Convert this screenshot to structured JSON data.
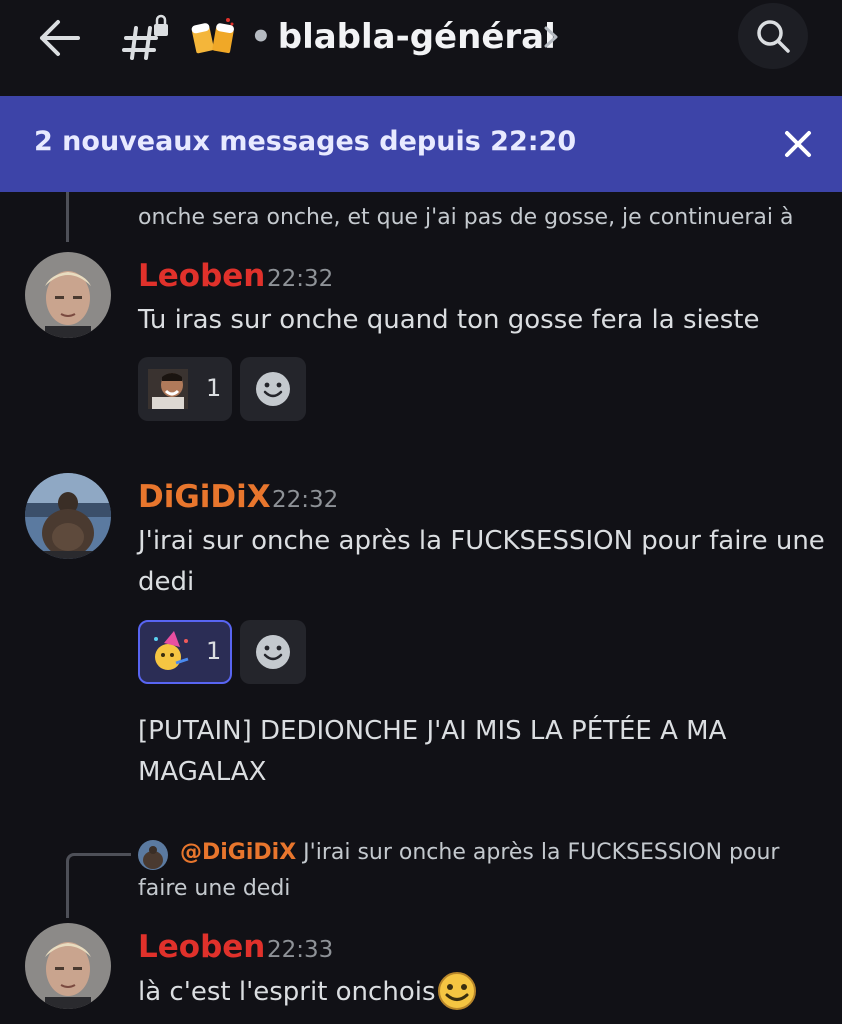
{
  "header": {
    "channel_name": "blabla-général",
    "separator": "•"
  },
  "banner": {
    "text": "2 nouveaux messages depuis 22:20"
  },
  "top_reply": {
    "text": "onche sera onche, et que j'ai pas de gosse, je continuerai à"
  },
  "messages": [
    {
      "author": "Leoben",
      "time": "22:32",
      "lines": [
        "Tu iras sur onche quand ton gosse fera la sieste"
      ],
      "reaction_count": "1"
    },
    {
      "author": "DiGiDiX",
      "time": "22:32",
      "lines": [
        "J'irai sur onche après la FUCKSESSION pour faire une",
        "dedi"
      ],
      "reaction_count": "1",
      "followup_lines": [
        "[PUTAIN] DEDIONCHE J'AI MIS LA PÉTÉE A MA",
        "MAGALAX"
      ]
    },
    {
      "reply": {
        "mention": "@DiGiDiX",
        "line1": "J'irai sur onche après la FUCKSESSION pour",
        "line2": "faire une dedi"
      },
      "author": "Leoben",
      "time": "22:33",
      "lines": [
        "là  c'est l'esprit onchois"
      ]
    }
  ],
  "colors": {
    "leoben": "#e0312b",
    "digidix": "#e8762d",
    "banner": "#3d44a8",
    "background": "#111116"
  },
  "icons": [
    "back-arrow-icon",
    "hashtag-lock-icon",
    "beer-mugs-emoji",
    "chevron-right-icon",
    "search-icon",
    "close-icon",
    "add-reaction-icon",
    "laughing-man-emoji",
    "party-emoji",
    "happy-face-emoji"
  ]
}
